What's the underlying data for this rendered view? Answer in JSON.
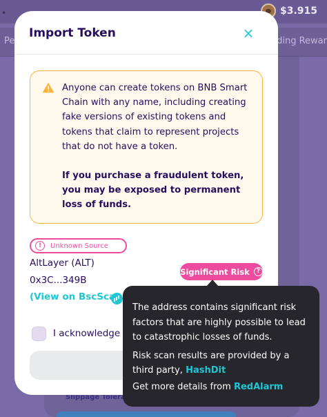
{
  "background": {
    "balance": "$3.915",
    "tab_left": "Pe",
    "tab_right": "ding Rewar",
    "slippage_label": "Slippage Toleranc"
  },
  "modal": {
    "title": "Import Token",
    "close_label": "×",
    "warning": {
      "text": "Anyone can create tokens on BNB Smart Chain with any name, including creating fake versions of existing tokens and tokens that claim to represent projects that do not have a token.",
      "bold_text": "If you purchase a fraudulent token, you may be exposed to permanent loss of funds."
    },
    "source_badge": {
      "icon": "!",
      "label": "Unknown Source"
    },
    "token": {
      "name": "AltLayer (ALT)",
      "address": "0x3C...349B",
      "scan_link": "(View on BscScan"
    },
    "risk_badge": {
      "label": "Significant Risk",
      "help": "?"
    },
    "acknowledge_label": "I acknowledge the risk"
  },
  "tooltip": {
    "line1": "The address contains significant risk factors that are highly possible to lead to catastrophic losses of funds.",
    "line2_prefix": "Risk scan results are provided by a third party,",
    "line2_link": "HashDit",
    "line3_prefix": "Get more details from",
    "line3_link": "RedAlarm"
  },
  "colors": {
    "primary_text": "#280d5f",
    "accent": "#1fc7d4",
    "danger": "#ed4b9e",
    "warning": "#ffb237",
    "tooltip_bg": "#27262c"
  }
}
